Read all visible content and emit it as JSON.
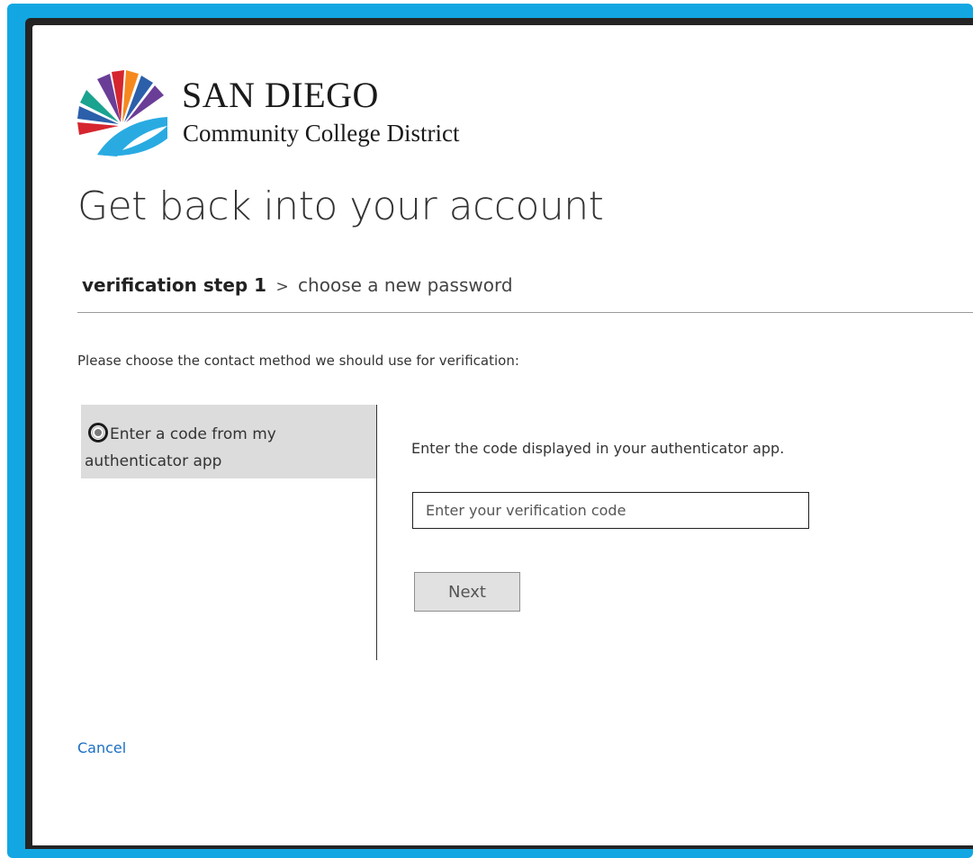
{
  "brand": {
    "name": "SAN DIEGO",
    "subtitle": "Community College District",
    "logo_icon": "sdccd-sunburst-logo",
    "colors": {
      "accent_frame": "#12a7e2",
      "logo_purple": "#6a3d97",
      "logo_red": "#d5262f",
      "logo_orange": "#f5891f",
      "logo_blue": "#2b5faa",
      "logo_teal": "#1aa38f",
      "logo_lightblue": "#29abe2"
    }
  },
  "page": {
    "title": "Get back into your account"
  },
  "breadcrumb": {
    "current_step": "verification step 1",
    "separator": ">",
    "next_step": "choose a new password"
  },
  "instructions": "Please choose the contact method we should use for verification:",
  "methods": [
    {
      "label": "Enter a code from my authenticator app",
      "selected": true
    }
  ],
  "verification": {
    "prompt": "Enter the code displayed in your authenticator app.",
    "input_placeholder": "Enter your verification code",
    "input_value": "",
    "next_label": "Next"
  },
  "cancel_label": "Cancel"
}
